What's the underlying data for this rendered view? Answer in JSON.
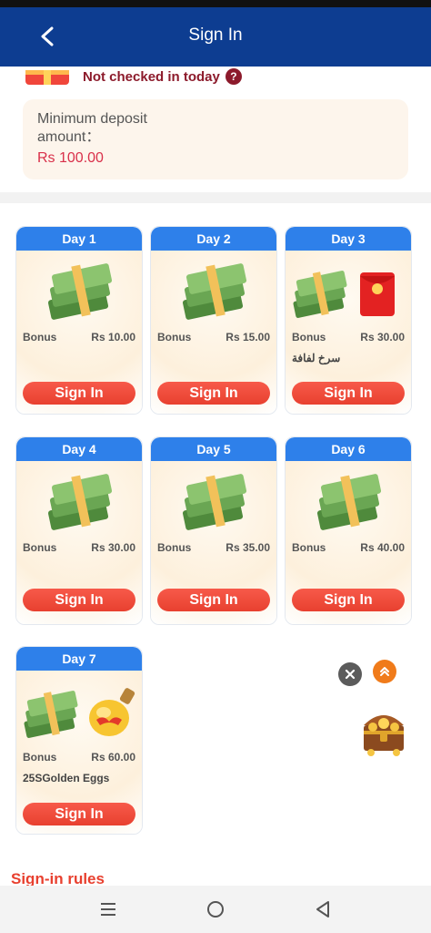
{
  "header": {
    "title": "Sign In"
  },
  "status": {
    "not_checked": "Not checked in today",
    "help": "?"
  },
  "deposit": {
    "label": "Minimum deposit amount：",
    "amount": "Rs 100.00"
  },
  "days": [
    {
      "day": "Day 1",
      "bonus_label": "Bonus",
      "bonus": "Rs 10.00",
      "extra": "",
      "button": "Sign In"
    },
    {
      "day": "Day 2",
      "bonus_label": "Bonus",
      "bonus": "Rs 15.00",
      "extra": "",
      "button": "Sign In"
    },
    {
      "day": "Day 3",
      "bonus_label": "Bonus",
      "bonus": "Rs 30.00",
      "extra": "سرخ لفافة",
      "button": "Sign In"
    },
    {
      "day": "Day 4",
      "bonus_label": "Bonus",
      "bonus": "Rs 30.00",
      "extra": "",
      "button": "Sign In"
    },
    {
      "day": "Day 5",
      "bonus_label": "Bonus",
      "bonus": "Rs 35.00",
      "extra": "",
      "button": "Sign In"
    },
    {
      "day": "Day 6",
      "bonus_label": "Bonus",
      "bonus": "Rs 40.00",
      "extra": "",
      "button": "Sign In"
    },
    {
      "day": "Day 7",
      "bonus_label": "Bonus",
      "bonus": "Rs 60.00",
      "extra": "25SGolden Eggs",
      "button": "Sign In"
    }
  ],
  "rules": {
    "title": "Sign-in rules"
  },
  "colors": {
    "header": "#0d3d91",
    "accent": "#e8402f",
    "day_tab": "#2e80ea",
    "deposit_text": "#d9304a"
  },
  "icons": {
    "back": "chevron-left-icon",
    "money": "cash-stack-icon",
    "red_envelope": "red-envelope-icon",
    "golden_egg": "golden-egg-icon",
    "treasure": "treasure-chest-icon"
  }
}
